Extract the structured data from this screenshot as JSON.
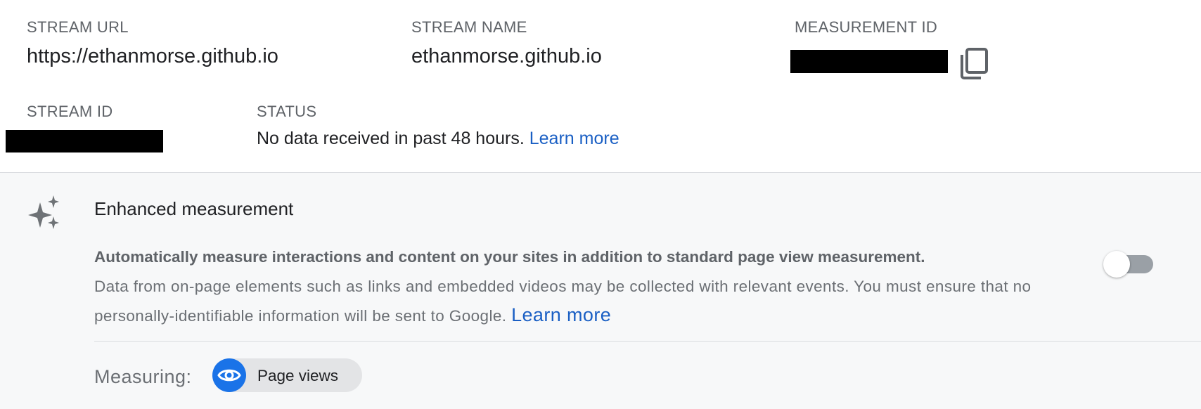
{
  "stream_details": {
    "stream_url": {
      "label": "STREAM URL",
      "value": "https://ethanmorse.github.io"
    },
    "stream_name": {
      "label": "STREAM NAME",
      "value": "ethanmorse.github.io"
    },
    "measurement_id": {
      "label": "MEASUREMENT ID",
      "redacted": true,
      "copy_icon": "copy-icon"
    },
    "stream_id": {
      "label": "STREAM ID",
      "redacted": true
    },
    "status": {
      "label": "STATUS",
      "text": "No data received in past 48 hours.",
      "link": "Learn more"
    }
  },
  "enhanced_measurement": {
    "icon": "sparkle-icon",
    "title": "Enhanced measurement",
    "description_bold": "Automatically measure interactions and content on your sites in addition to standard page view measurement.",
    "description": "Data from on-page elements such as links and embedded videos may be collected with relevant events. You must ensure that no personally-identifiable information will be sent to Google.",
    "link": "Learn more",
    "toggle_on": false,
    "measuring_label": "Measuring:",
    "chips": [
      {
        "label": "Page views",
        "icon": "eye-icon"
      }
    ]
  },
  "colors": {
    "link": "#1a5fc4",
    "chip_icon_bg": "#1a73e8",
    "toggle_track": "#9aa0a6",
    "panel_bg": "#f7f8f9"
  }
}
